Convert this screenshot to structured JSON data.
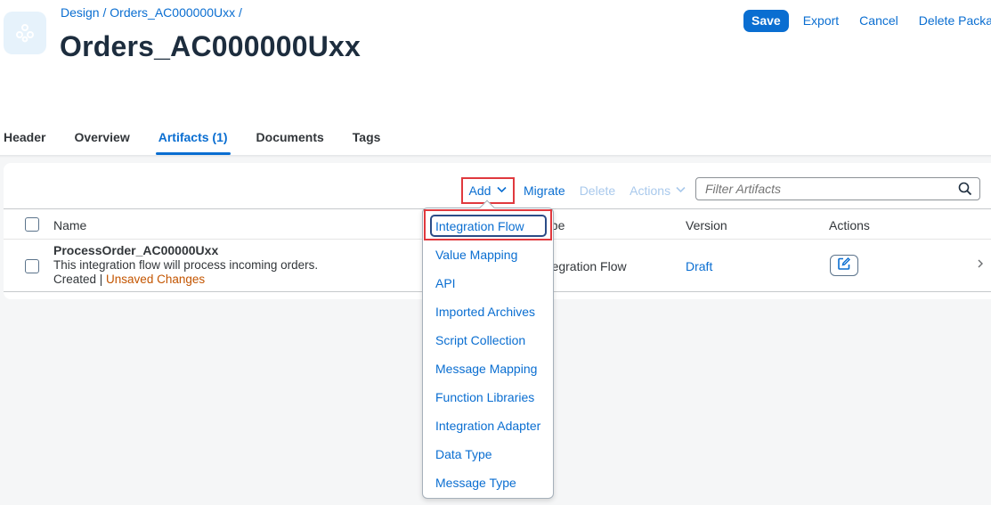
{
  "breadcrumb": {
    "design": "Design",
    "sep1": " / ",
    "package": "Orders_AC000000Uxx",
    "sep2": " /"
  },
  "page_title": "Orders_AC000000Uxx",
  "header_actions": {
    "save": "Save",
    "export": "Export",
    "cancel": "Cancel",
    "delete_package": "Delete Package"
  },
  "tabs": [
    {
      "label": "Header"
    },
    {
      "label": "Overview"
    },
    {
      "label": "Artifacts (1)"
    },
    {
      "label": "Documents"
    },
    {
      "label": "Tags"
    }
  ],
  "toolbar": {
    "add": "Add",
    "migrate": "Migrate",
    "delete": "Delete",
    "actions": "Actions"
  },
  "filter": {
    "placeholder": "Filter Artifacts"
  },
  "table": {
    "columns": {
      "name": "Name",
      "type": "Type",
      "version": "Version",
      "actions": "Actions"
    },
    "rows": [
      {
        "name": "ProcessOrder_AC00000Uxx",
        "description": "This integration flow will process incoming orders.",
        "status": "Created",
        "status_sep": " | ",
        "changes": "Unsaved Changes",
        "type": "Integration Flow",
        "version": "Draft"
      }
    ]
  },
  "add_menu": {
    "items": [
      "Integration Flow",
      "Value Mapping",
      "API",
      "Imported Archives",
      "Script Collection",
      "Message Mapping",
      "Function Libraries",
      "Integration Adapter",
      "Data Type",
      "Message Type"
    ]
  },
  "colors": {
    "accent": "#0a6ed1",
    "highlight_border": "#e0393e",
    "warning": "#c35500"
  }
}
